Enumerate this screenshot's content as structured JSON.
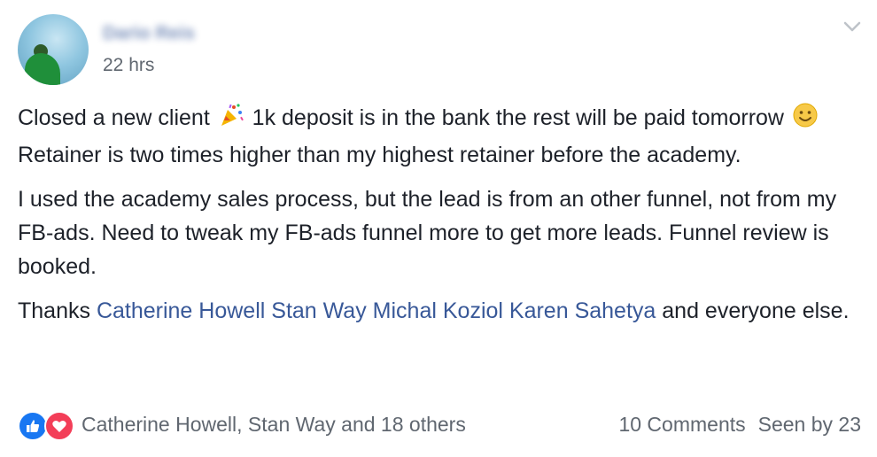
{
  "post": {
    "author": "Dario Reis",
    "time": "22 hrs",
    "paragraph1": {
      "part1": "Closed a new client ",
      "emoji1": "party-popper",
      "part2": " 1k deposit is in the bank the rest will be paid tomorrow ",
      "emoji2": "smiley",
      "part3": " Retainer is two times higher than my highest retainer before the academy."
    },
    "paragraph2": "I used the academy sales process, but the lead is from an other funnel, not from my FB-ads. Need to tweak my FB-ads funnel more to get more leads. Funnel review is booked.",
    "paragraph3": {
      "prefix": "Thanks ",
      "mentions": [
        "Catherine Howell",
        "Stan Way",
        "Michal Koziol",
        "Karen Sahetya"
      ],
      "suffix": " and everyone else."
    }
  },
  "footer": {
    "reactions_text": "Catherine Howell, Stan Way and 18 others",
    "comments": "10 Comments",
    "seen": "Seen by 23",
    "like_color": "#1877f2",
    "love_color": "#f33e58"
  },
  "colors": {
    "link": "#385898",
    "text": "#1d2129",
    "muted": "#606770"
  },
  "icons": {
    "menu": "chevron-down-icon",
    "like": "thumbs-up-icon",
    "love": "heart-icon"
  }
}
